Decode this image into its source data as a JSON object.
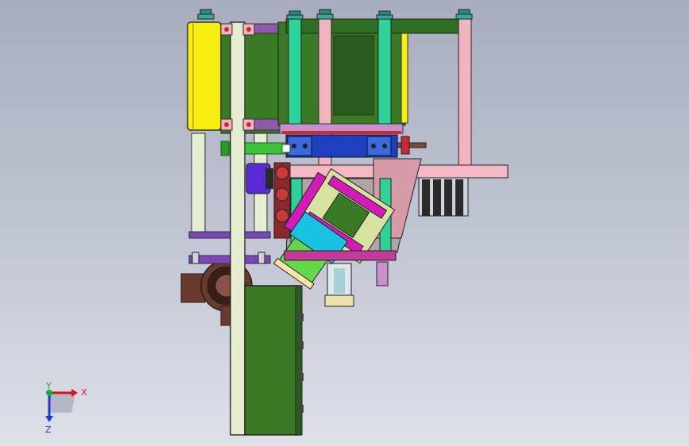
{
  "viewport": {
    "view": "cad-assembly-front-view",
    "background_top": "#a8acbe",
    "background_bottom": "#dfe0e8"
  },
  "triad": {
    "x_label": "X",
    "y_label": "Y",
    "z_label": "Z",
    "x_color": "#d8141a",
    "y_color": "#1faa2a",
    "z_color": "#1c3cc8"
  },
  "palette": {
    "frame_green": "#3a7a24",
    "dark_green": "#2c5a1f",
    "light_post": "#e6ecd0",
    "pink_post": "#f0b4be",
    "teal_post": "#2fd39a",
    "yellow_guard": "#f6ee10",
    "blue_bar": "#1e3fbf",
    "magenta_plate": "#d41ab8",
    "cyan_cylinder": "#18c2e2",
    "purple_roller": "#5b2bd6",
    "motor_brown": "#6a3a2e"
  }
}
